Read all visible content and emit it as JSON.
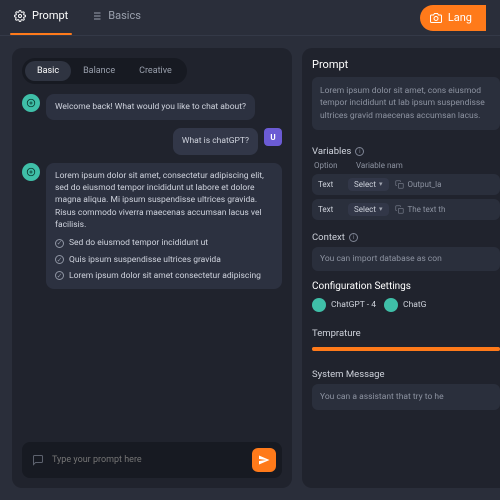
{
  "colors": {
    "accent": "#ff7a1a",
    "bot": "#3fbfa8",
    "user": "#6b5bd4"
  },
  "topbar": {
    "tabs": [
      {
        "label": "Prompt",
        "icon": "gear-icon",
        "active": true
      },
      {
        "label": "Basics",
        "icon": "list-icon",
        "active": false
      }
    ],
    "lang_button": {
      "icon": "camera-icon",
      "label": "Lang"
    }
  },
  "chat": {
    "mode_tabs": [
      "Basic",
      "Balance",
      "Creative"
    ],
    "mode_active": "Basic",
    "messages": {
      "bot_greeting": "Welcome back! What would you like to chat about?",
      "user_q": "What is chatGPT?",
      "user_initial": "U",
      "bot_long": "Lorem ipsum dolor sit amet, consectetur adipiscing elit, sed do eiusmod tempor incididunt ut labore et dolore magna aliqua. Mi ipsum suspendisse ultrices gravida. Risus commodo viverra maecenas accumsan lacus vel facilisis.",
      "checks": [
        "Sed do eiusmod tempor incididunt ut",
        "Quis ipsum suspendisse ultrices gravida",
        "Lorem ipsum dolor sit amet consectetur adipiscing"
      ]
    },
    "input_placeholder": "Type your prompt here"
  },
  "side": {
    "prompt": {
      "title": "Prompt",
      "body": "Lorem ipsum dolor sit amet, cons eiusmod tempor incididunt ut lab ipsum suspendisse ultrices gravid maecenas accumsan lacus."
    },
    "variables": {
      "title": "Variables",
      "headers": [
        "Option",
        "Variable nam"
      ],
      "rows": [
        {
          "option": "Text",
          "select": "Select",
          "name": "Output_la"
        },
        {
          "option": "Text",
          "select": "Select",
          "name": "The text th"
        }
      ]
    },
    "context": {
      "title": "Context",
      "body": "You can import database as con"
    },
    "config": {
      "title": "Configuration Settings",
      "models": [
        "ChatGPT - 4",
        "ChatG"
      ]
    },
    "temperature": {
      "title": "Temprature"
    },
    "system_message": {
      "title": "System Message",
      "body": "You can a assistant that try to he"
    }
  }
}
